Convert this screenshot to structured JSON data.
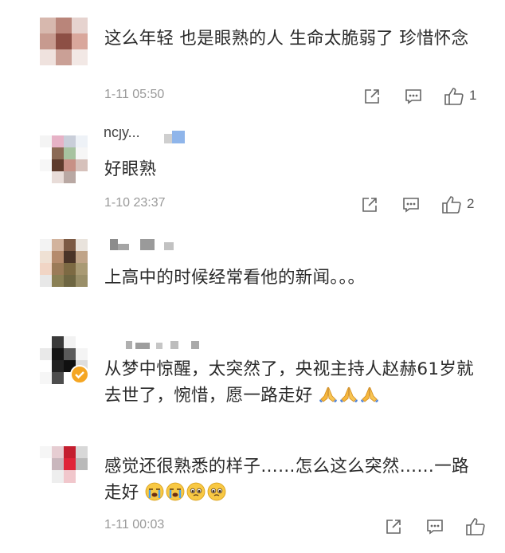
{
  "comments": [
    {
      "text": "这么年轻 也是眼熟的人 生命太脆弱了 珍惜怀念",
      "time": "1-11 05:50",
      "likes": "1"
    },
    {
      "username": "ncjy...",
      "text": "好眼熟",
      "time": "1-10 23:37",
      "likes": "2"
    },
    {
      "text": "上高中的时候经常看他的新闻。。。"
    },
    {
      "text": "从梦中惊醒，太突然了，央视主持人赵赫61岁就去世了，惋惜，愿一路走好"
    },
    {
      "text": "感觉还很熟悉的样子……怎么这么突然……一路走好",
      "time": "1-11 00:03"
    }
  ],
  "icons": {
    "share": "share-icon",
    "reply": "comment-icon",
    "like": "thumbs-up-icon",
    "pray": "praying-hands-emoji",
    "cry": "crying-face-emoji",
    "pleading": "pleading-face-emoji",
    "verified": "verified-badge-icon"
  },
  "colors": {
    "text": "#2a2a2a",
    "meta": "#999999",
    "icon": "#666666",
    "verified": "#f5a623"
  }
}
